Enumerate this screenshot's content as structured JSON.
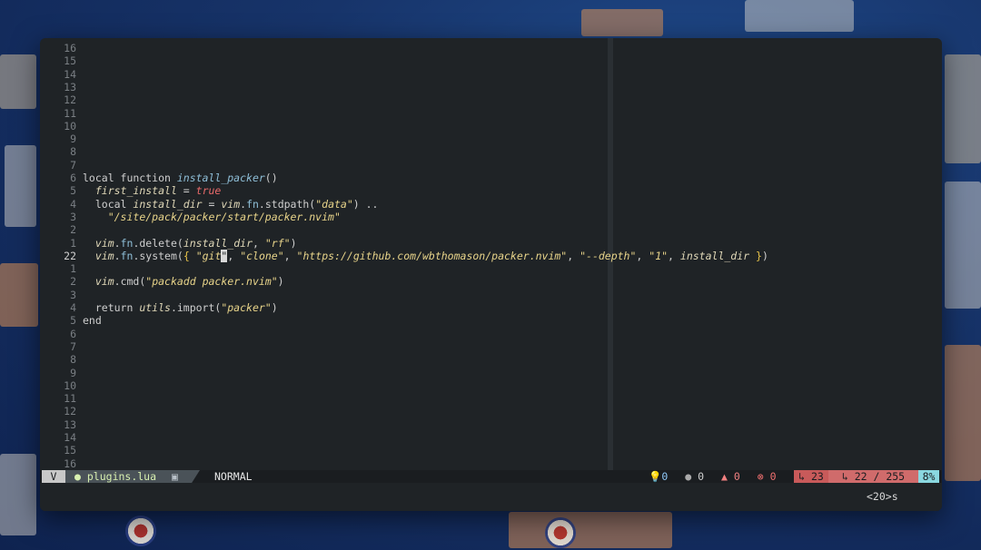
{
  "colors": {
    "background": "#1f2326",
    "statusline": "#1a1d20",
    "string": "#e8d48a",
    "boolean": "#e86a6a",
    "function": "#8fbfd8",
    "position_bg": "#d06b6b",
    "percent_bg": "#8ad8e0"
  },
  "editor": {
    "line_numbers": [
      "16",
      "15",
      "14",
      "13",
      "12",
      "11",
      "10",
      "9",
      "8",
      "7",
      "6",
      "5",
      "4",
      "3",
      "2",
      "1",
      "22",
      "1",
      "2",
      "3",
      "4",
      "5",
      "6",
      "7",
      "8",
      "9",
      "10",
      "11",
      "12",
      "13",
      "14",
      "15",
      "16"
    ],
    "current_line_index": 16
  },
  "code": {
    "l6": [
      "local function ",
      "install_packer",
      "()"
    ],
    "l5": [
      "  ",
      "first_install",
      " = ",
      "true"
    ],
    "l4": [
      "  local ",
      "install_dir",
      " = ",
      "vim",
      ".",
      "fn",
      ".stdpath(",
      "\"data\"",
      ") .."
    ],
    "l3": [
      "    ",
      "\"/site/pack/packer/start/packer.nvim\""
    ],
    "l1": [
      "  ",
      "vim",
      ".",
      "fn",
      ".delete(",
      "install_dir",
      ", ",
      "\"rf\"",
      ")"
    ],
    "l22": [
      "  ",
      "vim",
      ".",
      "fn",
      ".system(",
      "{",
      " \"git",
      "\"",
      ", ",
      "\"clone\"",
      ", ",
      "\"https://github.com/wbthomason/packer.nvim\"",
      ", ",
      "\"--depth\"",
      ", ",
      "\"1\"",
      ", ",
      "install_dir",
      " ",
      "}",
      ")"
    ],
    "l2b": [
      "  ",
      "vim",
      ".cmd(",
      "\"packadd packer.nvim\"",
      ")"
    ],
    "l4b": [
      "  return ",
      "utils",
      ".import(",
      "\"packer\"",
      ")"
    ],
    "l5b": [
      "end"
    ]
  },
  "statusline": {
    "vim_icon": "V",
    "file_icon": "lua-icon",
    "filename": "plugins.lua",
    "readonly_icon": "▣",
    "mode": "NORMAL",
    "hints": "0",
    "info": "0",
    "warnings": "0",
    "errors": "0",
    "col": "↳ 23",
    "line_pos": "↳ 22 / 255",
    "percent": "8%"
  },
  "cmdline": {
    "pending_keys": "<20>s"
  }
}
